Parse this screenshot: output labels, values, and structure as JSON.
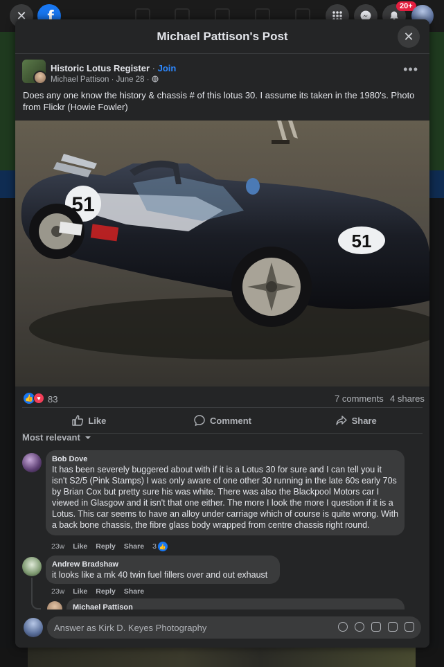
{
  "modal": {
    "title": "Michael Pattison's Post"
  },
  "notifications": {
    "badge": "20+"
  },
  "post": {
    "group_name": "Historic Lotus Register",
    "join_label": "Join",
    "separator": "·",
    "author": "Michael Pattison",
    "date": "June 28",
    "text": "Does any one know the history & chassis # of this lotus 30. I assume its taken in the 1980's. Photo from Flickr (Howie Fowler)",
    "reactions_count": "83",
    "comments": "7 comments",
    "shares": "4 shares"
  },
  "actions": {
    "like": "Like",
    "comment": "Comment",
    "share": "Share"
  },
  "sort_label": "Most relevant",
  "comments": [
    {
      "author": "Bob Dove",
      "text": "It has been severely buggered about with if it is a Lotus 30 for sure and I can tell you it isn't S2/5 (Pink Stamps) I was only aware of one other 30 running in the late 60s early 70s by Brian Cox but pretty sure his was white. There was also the Blackpool Motors car I viewed in Glasgow and it isn't that one either. The more I look the more I question if it is a Lotus. This car seems to have an alloy under carriage which of course is quite wrong. With a back bone chassis, the fibre glass body wrapped from centre chassis right round.",
      "time": "23w",
      "like": "Like",
      "reply": "Reply",
      "share": "Share",
      "likes": "3"
    },
    {
      "author": "Andrew Bradshaw",
      "text": "it looks like a mk 40 twin fuel fillers over and out exhaust",
      "time": "23w",
      "like": "Like",
      "reply": "Reply",
      "share": "Share"
    },
    {
      "author": "Michael Pattison"
    }
  ],
  "reply": {
    "placeholder": "Answer as Kirk D. Keyes Photography"
  },
  "photo": {
    "car_number": "51"
  },
  "colors": {
    "accent": "#2d88ff",
    "like_blue": "#1877f2",
    "love_red": "#f33e58",
    "badge_red": "#e41e3f"
  }
}
